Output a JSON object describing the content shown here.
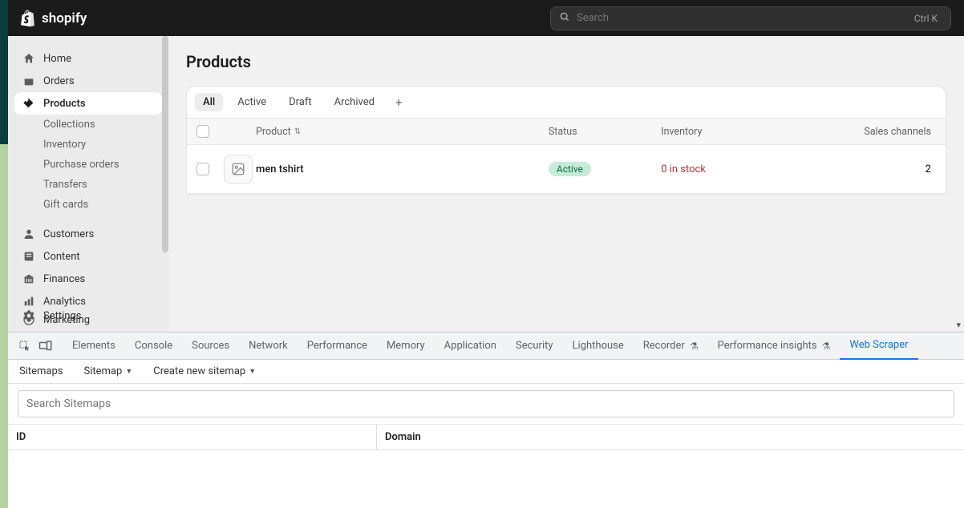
{
  "header": {
    "brand": "shopify",
    "search_placeholder": "Search",
    "shortcut": "Ctrl K"
  },
  "sidebar": {
    "home": "Home",
    "orders": "Orders",
    "products": "Products",
    "collections": "Collections",
    "inventory": "Inventory",
    "purchase_orders": "Purchase orders",
    "transfers": "Transfers",
    "gift_cards": "Gift cards",
    "customers": "Customers",
    "content": "Content",
    "finances": "Finances",
    "analytics": "Analytics",
    "marketing": "Marketing",
    "settings": "Settings"
  },
  "page": {
    "title": "Products",
    "tabs": {
      "all": "All",
      "active": "Active",
      "draft": "Draft",
      "archived": "Archived"
    },
    "columns": {
      "product": "Product",
      "status": "Status",
      "inventory": "Inventory",
      "channels": "Sales channels"
    },
    "rows": [
      {
        "name": "men tshirt",
        "status": "Active",
        "inventory": "0 in stock",
        "channels": "2"
      }
    ]
  },
  "devtools": {
    "tabs": {
      "elements": "Elements",
      "console": "Console",
      "sources": "Sources",
      "network": "Network",
      "performance": "Performance",
      "memory": "Memory",
      "application": "Application",
      "security": "Security",
      "lighthouse": "Lighthouse",
      "recorder": "Recorder",
      "perf_insights": "Performance insights",
      "web_scraper": "Web Scraper"
    },
    "subtabs": {
      "sitemaps": "Sitemaps",
      "sitemap": "Sitemap",
      "create": "Create new sitemap"
    },
    "search_placeholder": "Search Sitemaps",
    "th": {
      "id": "ID",
      "domain": "Domain"
    }
  }
}
